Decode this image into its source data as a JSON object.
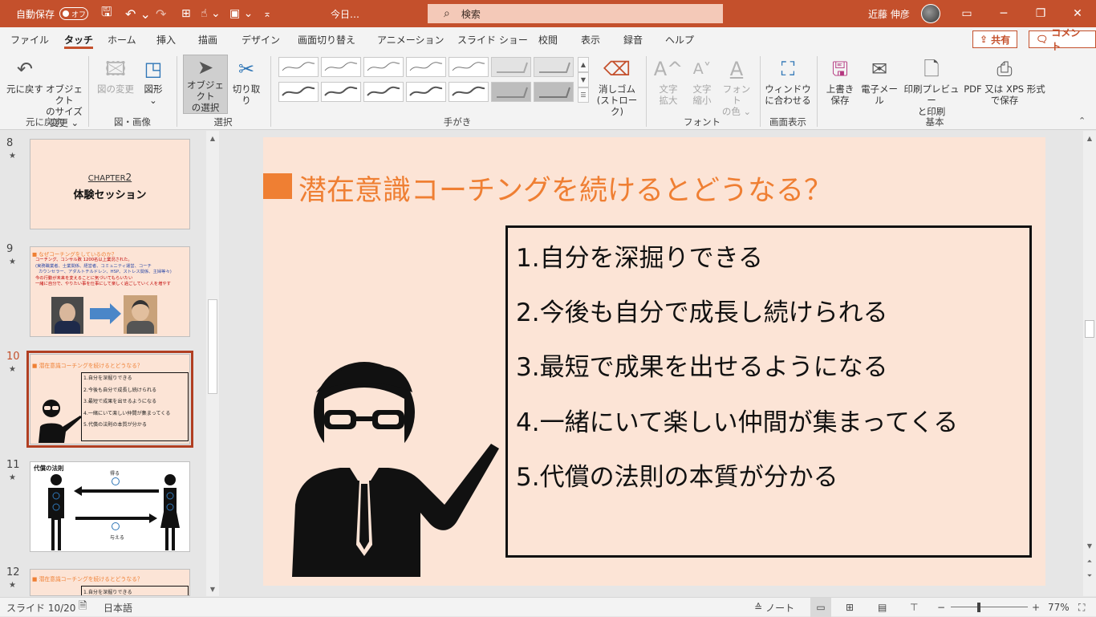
{
  "titlebar": {
    "autosave_label": "自動保存",
    "autosave_state": "オフ",
    "doc_title": "今日…",
    "doc_title_more": "⌄",
    "search_placeholder": "検索",
    "user_name": "近藤 伸彦"
  },
  "tabs": [
    {
      "label": "ファイル"
    },
    {
      "label": "タッチ"
    },
    {
      "label": "ホーム"
    },
    {
      "label": "挿入"
    },
    {
      "label": "描画"
    },
    {
      "label": "デザイン"
    },
    {
      "label": "画面切り替え"
    },
    {
      "label": "アニメーション"
    },
    {
      "label": "スライド ショー"
    },
    {
      "label": "校閲"
    },
    {
      "label": "表示"
    },
    {
      "label": "録音"
    },
    {
      "label": "ヘルプ"
    }
  ],
  "share_label": "共有",
  "comment_label": "コメント",
  "ribbon": {
    "undo": {
      "label1": "元に戻す",
      "label2": "",
      "group": "元に戻す"
    },
    "object_size": {
      "label1": "オブジェクト",
      "label2": "のサイズ変更 ⌄"
    },
    "change_picture": {
      "label1": "図の変更",
      "label2": ""
    },
    "shapes": {
      "label1": "図形",
      "label2": "⌄"
    },
    "image_group": "図・画像",
    "select_object": {
      "label1": "オブジェクト",
      "label2": "の選択"
    },
    "cut": {
      "label1": "切り取り",
      "label2": ""
    },
    "select_group": "選択",
    "handwriting_group": "手がき",
    "eraser": {
      "label1": "消しゴム",
      "label2": "(ストローク)"
    },
    "font_grow": {
      "label1": "文字",
      "label2": "拡大"
    },
    "font_shrink": {
      "label1": "文字",
      "label2": "縮小"
    },
    "font_color": {
      "label1": "フォント",
      "label2": "の色 ⌄"
    },
    "font_group": "フォント",
    "fit_window": {
      "label1": "ウィンドウ",
      "label2": "に合わせる"
    },
    "display_group": "画面表示",
    "save": {
      "label1": "上書き",
      "label2": "保存"
    },
    "email": {
      "label1": "電子メール",
      "label2": ""
    },
    "print_preview": {
      "label1": "印刷プレビュー",
      "label2": "と印刷"
    },
    "pdf": {
      "label1": "PDF 又は XPS 形式",
      "label2": "で保存"
    },
    "basic_group": "基本"
  },
  "thumbnails": [
    {
      "num": "8",
      "chapter": "CHAPTER",
      "chapter_num": "2",
      "title": "体験セッション"
    },
    {
      "num": "9",
      "title": "■ なぜコーチングをしているのか？",
      "lines": [
        "コーチング、コンサル数 1200名以上業況された。",
        "(実務職業者、士業関係、経営者、コミュニティ運営、コーチ",
        "カウンセラー、アダルトチルドレン、HSP、ストレス関係、主婦等々)",
        "今の行動が未来を変えることに気づいてもらいたい",
        "一緒に自分で、やりたい事を仕事にして楽しく過ごしていく人を増やす"
      ]
    },
    {
      "num": "10",
      "title": "■ 潜在意識コーチングを続けるとどうなる？",
      "lines": [
        "1.自分を深掘りできる",
        "2.今後も自分で成長し続けられる",
        "3.最短で成果を出せるようになる",
        "4.一緒にいて楽しい仲間が集まってくる",
        "5.代償の法則の本質が分かる"
      ]
    },
    {
      "num": "11",
      "title": "代償の法則",
      "top_label": "得る",
      "bottom_label": "与える"
    },
    {
      "num": "12",
      "title": "■ 潜在意識コーチングを続けるとどうなる？",
      "lines": [
        "1.自分を深掘りできる"
      ]
    }
  ],
  "star": "★",
  "slide": {
    "title": "潜在意識コーチングを続けるとどうなる？",
    "items": [
      "1.自分を深掘りできる",
      "2.今後も自分で成長し続けられる",
      "3.最短で成果を出せるようになる",
      "4.一緒にいて楽しい仲間が集まってくる",
      "5.代償の法則の本質が分かる"
    ],
    "accent_color": "#ef7f33",
    "background_color": "#fce4d6"
  },
  "status": {
    "slide_counter": "スライド 10/20",
    "language": "日本語",
    "notes_label": "ノート",
    "zoom": "77%",
    "zoom_minus": "−",
    "zoom_plus": "+"
  }
}
